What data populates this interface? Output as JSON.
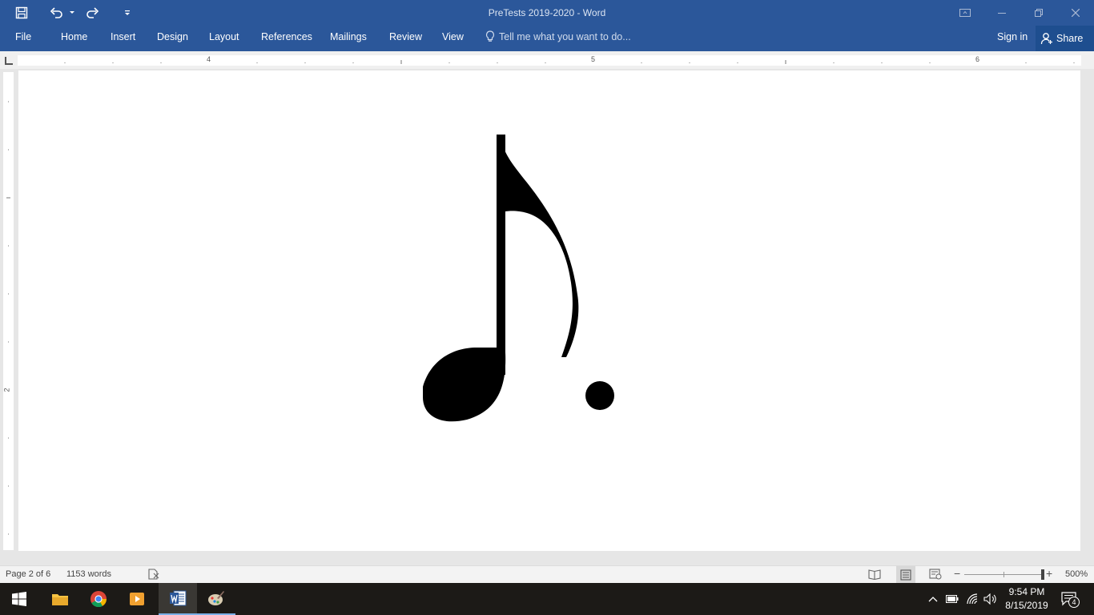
{
  "window": {
    "title": "PreTests 2019-2020 - Word"
  },
  "ribbon": {
    "tabs": [
      "File",
      "Home",
      "Insert",
      "Design",
      "Layout",
      "References",
      "Mailings",
      "Review",
      "View"
    ],
    "tell_me_placeholder": "Tell me what you want to do...",
    "sign_in": "Sign in",
    "share": "Share"
  },
  "ruler": {
    "horizontal_numbers": [
      "4",
      "5",
      "6"
    ],
    "vertical_numbers": [
      "2"
    ]
  },
  "document": {
    "content": "dotted-eighth-note-symbol"
  },
  "status_bar": {
    "page": "Page 2 of 6",
    "words": "1153 words",
    "zoom": "500%",
    "zoom_level": 5.0
  },
  "taskbar": {
    "apps": [
      "start-icon",
      "file-explorer-icon",
      "chrome-icon",
      "media-player-icon",
      "word-icon",
      "paint-icon"
    ],
    "time": "9:54 PM",
    "date": "8/15/2019",
    "notification_count": "4"
  },
  "colors": {
    "ribbon": "#2b579a",
    "taskbar": "#1c1a17",
    "accent": "#2b579a"
  }
}
